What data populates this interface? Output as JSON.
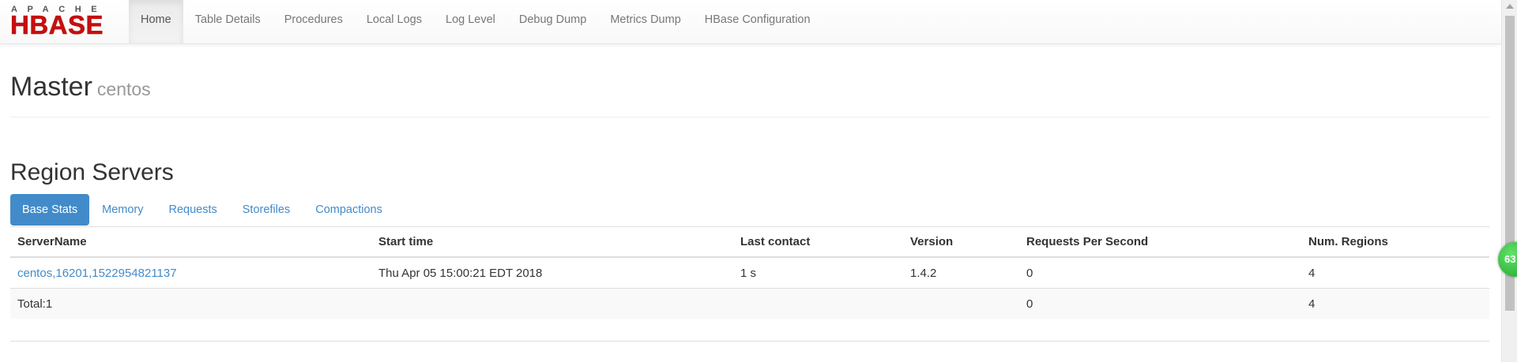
{
  "brand": {
    "top": "APACHE",
    "name": "HBASE"
  },
  "nav": {
    "items": [
      "Home",
      "Table Details",
      "Procedures",
      "Local Logs",
      "Log Level",
      "Debug Dump",
      "Metrics Dump",
      "HBase Configuration"
    ],
    "active": "Home"
  },
  "header": {
    "title": "Master",
    "subtitle": "centos"
  },
  "region_servers": {
    "title": "Region Servers",
    "tabs": [
      "Base Stats",
      "Memory",
      "Requests",
      "Storefiles",
      "Compactions"
    ],
    "active_tab": "Base Stats",
    "columns": [
      "ServerName",
      "Start time",
      "Last contact",
      "Version",
      "Requests Per Second",
      "Num. Regions"
    ],
    "rows": [
      [
        "centos,16201,1522954821137",
        "Thu Apr 05 15:00:21 EDT 2018",
        "1 s",
        "1.4.2",
        "0",
        "4"
      ]
    ],
    "total": {
      "label": "Total:1",
      "requests": "0",
      "regions": "4"
    }
  },
  "badge": "63",
  "colors": {
    "accent": "#428bca",
    "brand_red": "#c40f0f",
    "nav_text": "#777777"
  }
}
